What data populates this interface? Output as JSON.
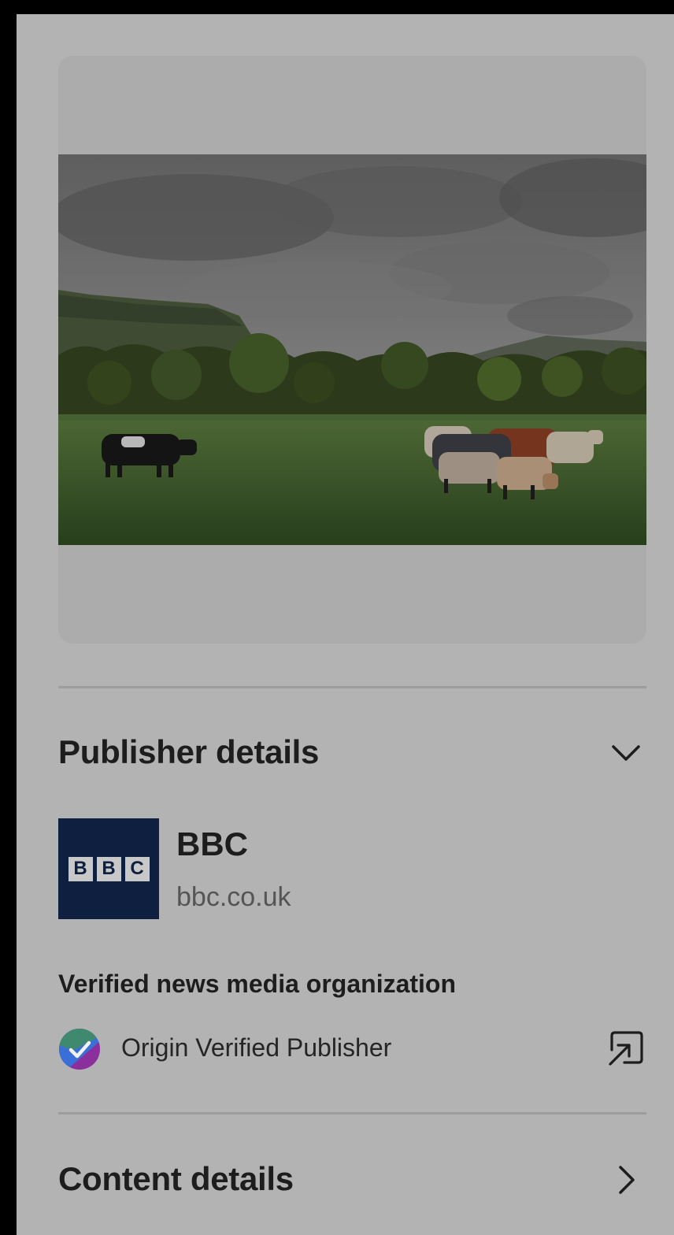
{
  "image_card": {
    "image_description_icon": "photo-thumbnail"
  },
  "publisher_section": {
    "title": "Publisher details",
    "toggle_icon": "chevron-down-icon",
    "publisher": {
      "logo_letters": [
        "B",
        "B",
        "C"
      ],
      "name": "BBC",
      "domain": "bbc.co.uk"
    },
    "verification": {
      "heading": "Verified news media organization",
      "badge_icon": "verified-check-badge-icon",
      "label": "Origin Verified Publisher",
      "link_icon": "external-link-icon"
    }
  },
  "content_section": {
    "title": "Content details",
    "toggle_icon": "chevron-right-icon"
  },
  "colors": {
    "background_dim": "#b3b3b3",
    "frame": "#000000",
    "bbc_navy": "#0e1f3f",
    "badge_green": "#3f8a6e",
    "badge_blue": "#3b6fd8",
    "badge_purple": "#8a2f9c",
    "text_primary": "#1d1d1d",
    "text_secondary": "#555555"
  }
}
